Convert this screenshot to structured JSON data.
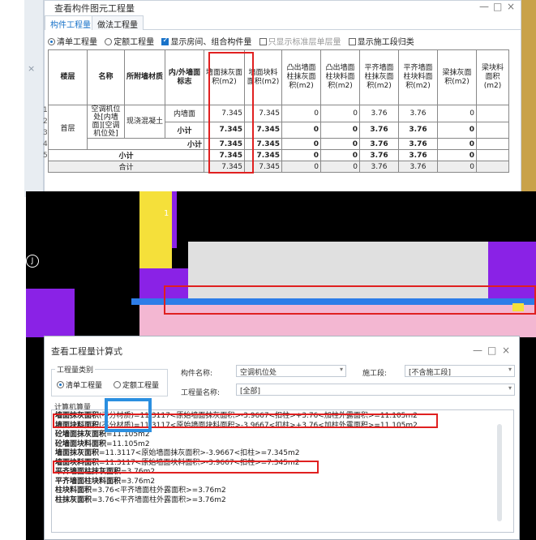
{
  "top_window": {
    "title": "查看构件图元工程量",
    "tabs": [
      "构件工程量",
      "做法工程量"
    ],
    "options": {
      "radio_list": "清单工程量",
      "radio_quota": "定额工程量",
      "chk_rooms": "显示房间、组合构件量",
      "chk_std": "只显示标准层单层量",
      "chk_segment": "显示施工段归类"
    },
    "table": {
      "headers": [
        "楼层",
        "名称",
        "所附墙材质",
        "内/外墙面标志",
        "墙面抹灰面积(m2)",
        "墙面块料面积(m2)",
        "凸出墙面柱抹灰面积(m2)",
        "凸出墙面柱块料面积(m2)",
        "平齐墙面柱抹灰面积(m2)",
        "平齐墙面柱块料面积(m2)",
        "梁抹灰面积(m2)",
        "梁块料面积(m2)"
      ],
      "row_numbers": [
        "1",
        "2",
        "3",
        "4",
        "5"
      ],
      "floor": "首层",
      "name": "空调机位处[内墙面][空调机位处]",
      "material": "现浇混凝土",
      "wall_flag": "内墙面",
      "subtotal_label": "小计",
      "total_label": "合计",
      "rows": [
        [
          "7.345",
          "7.345",
          "0",
          "0",
          "3.76",
          "3.76",
          "0",
          ""
        ],
        [
          "7.345",
          "7.345",
          "0",
          "0",
          "3.76",
          "3.76",
          "0",
          ""
        ],
        [
          "7.345",
          "7.345",
          "0",
          "0",
          "3.76",
          "3.76",
          "0",
          ""
        ],
        [
          "7.345",
          "7.345",
          "0",
          "0",
          "3.76",
          "3.76",
          "0",
          ""
        ],
        [
          "7.345",
          "7.345",
          "0",
          "0",
          "3.76",
          "3.76",
          "0",
          ""
        ]
      ]
    }
  },
  "dialog": {
    "title": "查看工程量计算式",
    "category_label": "工程量类别",
    "radio_list": "清单工程量",
    "radio_quota": "定额工程量",
    "component_name_label": "构件名称:",
    "component_name_value": "空调机位处",
    "segment_label": "施工段:",
    "segment_value": "[不含施工段]",
    "quantity_name_label": "工程量名称:",
    "quantity_name_value": "[全部]",
    "calc_label": "计算机算量",
    "lines": [
      {
        "bold": "墙面抹灰面积",
        "rest": "(不分材质)=11.3117<原始墙面抹灰面积>-3.9667<扣柱>+3.76<加柱外露面积>=11.105m2"
      },
      {
        "bold": "墙面块料面积",
        "rest": "(不分材质)=11.3117<原始墙面块料面积>-3.9667<扣柱>+3.76<加柱外露面积>=11.105m2"
      },
      {
        "bold": "砼墙面抹灰面积",
        "rest": "=11.105m2"
      },
      {
        "bold": "砼墙面块料面积",
        "rest": "=11.105m2"
      },
      {
        "bold": "墙面抹灰面积",
        "rest": "=11.3117<原始墙面抹灰面积>-3.9667<扣柱>=7.345m2"
      },
      {
        "bold": "墙面块料面积",
        "rest": "=11.3117<原始墙面块料面积>-3.9667<扣柱>=7.345m2"
      },
      {
        "bold": "平齐墙面柱抹灰面积",
        "rest": "=3.76m2"
      },
      {
        "bold": "平齐墙面柱块料面积",
        "rest": "=3.76m2"
      },
      {
        "bold": "柱块料面积",
        "rest": "=3.76<平齐墙面柱外露面积>=3.76m2"
      },
      {
        "bold": "柱抹灰面积",
        "rest": "=3.76<平齐墙面柱外露面积>=3.76m2"
      }
    ]
  },
  "cad": {
    "axis_label": "J",
    "marker_label": "1"
  },
  "colors": {
    "accent": "#1a73c9",
    "highlight_red": "#e02020",
    "highlight_blue": "#2b8fe0",
    "cad_purple": "#8a22e6",
    "cad_blue": "#2d7de8",
    "cad_pink": "#f0a0c8",
    "cad_yellow": "#f5e03a"
  },
  "window_controls": {
    "minimize": "—",
    "maximize": "□",
    "close": "×"
  }
}
